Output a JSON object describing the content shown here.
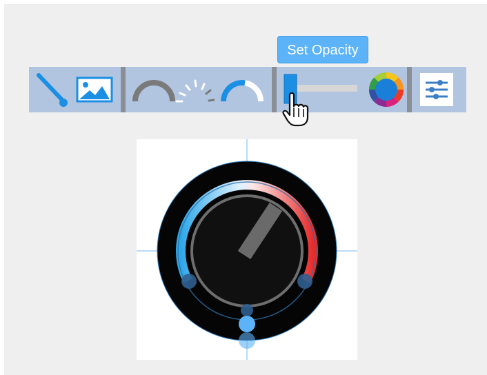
{
  "tooltip": {
    "text": "Set Opacity"
  },
  "toolbar": {
    "tools": [
      {
        "name": "needle",
        "icon": "needle-icon"
      },
      {
        "name": "background-image",
        "icon": "image-icon"
      },
      {
        "name": "track-arc",
        "icon": "arc-icon"
      },
      {
        "name": "tick-marks",
        "icon": "ticks-icon"
      },
      {
        "name": "value-arc",
        "icon": "progress-arc-icon"
      },
      {
        "name": "opacity-slider",
        "icon": "slider-icon"
      },
      {
        "name": "color-picker",
        "icon": "color-wheel-icon"
      },
      {
        "name": "settings",
        "icon": "sliders-settings-icon"
      }
    ],
    "opacity_level": 0.1
  },
  "colors": {
    "toolbar_bg": "#b1c4e0",
    "separator": "#8b8e94",
    "tooltip_bg": "#5cb3f8",
    "accent_blue": "#1a8fe3",
    "gauge_cold": "#2ea7e8",
    "gauge_hot": "#e62b2b",
    "knob": "#111111",
    "needle": "#6a6a6a"
  }
}
